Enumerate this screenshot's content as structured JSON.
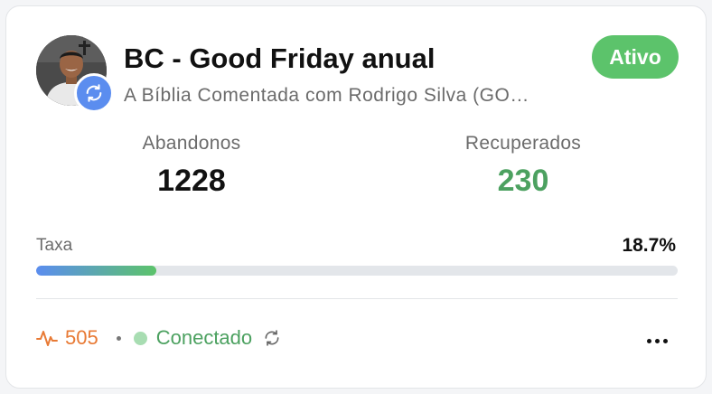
{
  "card": {
    "title": "BC - Good Friday anual",
    "subtitle": "A Bíblia Comentada com Rodrigo Silva (GO…",
    "status": "Ativo",
    "avatar_icon": "person-avatar",
    "badge_icon": "sync-icon"
  },
  "stats": {
    "abandonos_label": "Abandonos",
    "abandonos_value": "1228",
    "recuperados_label": "Recuperados",
    "recuperados_value": "230"
  },
  "rate": {
    "label": "Taxa",
    "value": "18.7%",
    "fraction": 0.187
  },
  "footer": {
    "activity_icon": "activity-pulse-icon",
    "activity_count": "505",
    "connection_label": "Conectado",
    "refresh_icon": "refresh-icon",
    "more_icon": "more-horizontal-icon"
  },
  "colors": {
    "status_green": "#5cc36b",
    "recovered_green": "#4ca160",
    "activity_orange": "#e87a35",
    "badge_blue": "#5b8def",
    "connected_dot": "#a8ddb2"
  }
}
